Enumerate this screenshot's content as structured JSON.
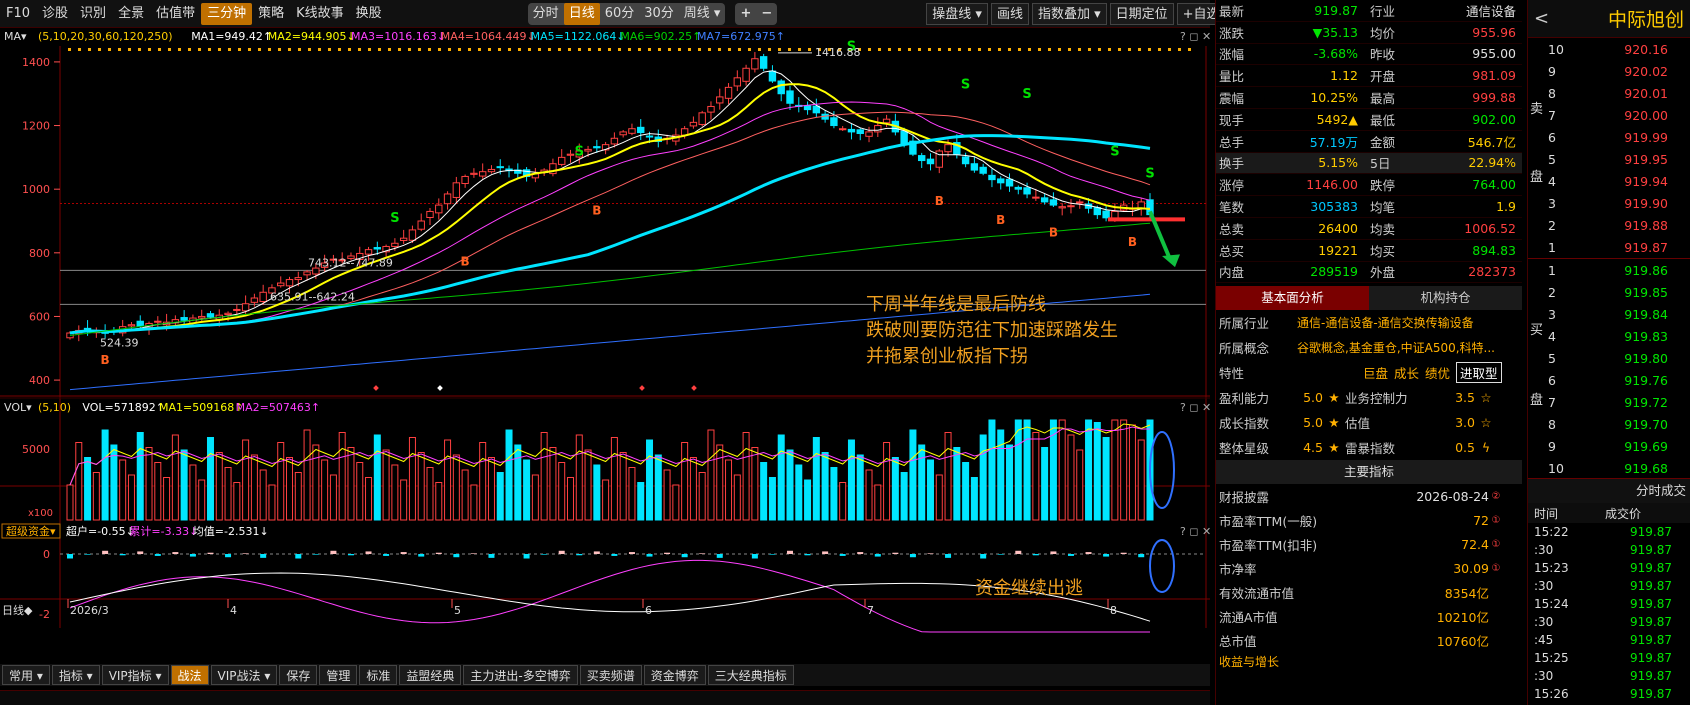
{
  "topbar": {
    "items": [
      {
        "id": "f10",
        "label": "F10",
        "active": false
      },
      {
        "id": "diagnose",
        "label": "诊股",
        "active": false
      },
      {
        "id": "identify",
        "label": "识別",
        "active": false
      },
      {
        "id": "overview",
        "label": "全景",
        "active": false
      },
      {
        "id": "valuation",
        "label": "估值带",
        "active": false
      },
      {
        "id": "three",
        "label": "三分钟",
        "active": true
      },
      {
        "id": "strategy",
        "label": "策略",
        "active": false
      },
      {
        "id": "kstory",
        "label": "K线故事",
        "active": false
      },
      {
        "id": "switch",
        "label": "换股",
        "active": false
      }
    ],
    "periods": [
      {
        "label": "分时",
        "active": false
      },
      {
        "label": "日线",
        "active": true
      },
      {
        "label": "60分",
        "active": false
      },
      {
        "label": "30分",
        "active": false
      },
      {
        "label": "周线 ▾",
        "active": false
      }
    ],
    "zoom_in": "+",
    "zoom_out": "−",
    "right": [
      "操盘线 ▾",
      "画线",
      "指数叠加 ▾",
      "日期定位",
      "+自选 ▾"
    ],
    "help": "?",
    "gear": "⚙"
  },
  "ma_header": {
    "label": "MA▾",
    "params": "(5,10,20,30,60,120,250)",
    "items": [
      {
        "text": "MA1=949.42↑",
        "color": "#ffffff"
      },
      {
        "text": "MA2=944.905↓",
        "color": "#ffff00"
      },
      {
        "text": "MA3=1016.163↓",
        "color": "#ff40ff"
      },
      {
        "text": "MA4=1064.449↓",
        "color": "#ff6060"
      },
      {
        "text": "MA5=1122.064↓",
        "color": "#00e5ff"
      },
      {
        "text": "MA6=902.25↑",
        "color": "#00d000"
      },
      {
        "text": "MA7=672.975↑",
        "color": "#4080ff"
      }
    ]
  },
  "vol_header": {
    "label": "VOL▾",
    "params": "(5,10)",
    "items": [
      {
        "text": "VOL=571892↑",
        "color": "#ffffff"
      },
      {
        "text": "MA1=509168↑",
        "color": "#ffff00"
      },
      {
        "text": "MA2=507463↑",
        "color": "#ff40ff"
      }
    ]
  },
  "fund_header": {
    "label": "超级资金▾",
    "items": [
      {
        "text": "超户=-0.55↓",
        "color": "#ffffff"
      },
      {
        "text": "累计=-3.33↓",
        "color": "#ff40ff"
      },
      {
        "text": "均值=-2.531↓",
        "color": "#ffffff"
      }
    ]
  },
  "panel_buttons": "? ◻ ✕",
  "price_axis": [
    "1400",
    "1200",
    "1000",
    "800",
    "600",
    "400"
  ],
  "vol_axis": [
    "5000",
    "x100"
  ],
  "fund_axis": [
    "0",
    "-2"
  ],
  "date_axis": {
    "label": "日线◆",
    "ticks": [
      "2026/3",
      "4",
      "5",
      "6",
      "7",
      "8"
    ]
  },
  "annotations": {
    "high": "1416.88",
    "low": "524.39",
    "lvl1": "743.12--747.89",
    "lvl2": "635.91--642.24",
    "note1": "下周半年线是最后防线",
    "note2": "跌破则要防范往下加速踩踏发生",
    "note3": "并拖累创业板指下拐",
    "note4": "资金继续出逃"
  },
  "chart_data": {
    "type": "candlestick",
    "x_range": [
      "2026-03",
      "2026-08"
    ],
    "y_range": [
      350,
      1450
    ],
    "closes": [
      548,
      556,
      560,
      552,
      547,
      555,
      568,
      574,
      570,
      578,
      585,
      582,
      590,
      588,
      595,
      600,
      598,
      604,
      610,
      622,
      640,
      658,
      676,
      690,
      705,
      716,
      722,
      740,
      752,
      768,
      780,
      778,
      790,
      798,
      810,
      812,
      820,
      830,
      846,
      872,
      900,
      930,
      950,
      985,
      1020,
      1040,
      1050,
      1055,
      1062,
      1070,
      1058,
      1050,
      1040,
      1048,
      1060,
      1080,
      1100,
      1110,
      1120,
      1125,
      1130,
      1140,
      1160,
      1180,
      1190,
      1178,
      1166,
      1150,
      1160,
      1170,
      1190,
      1210,
      1240,
      1260,
      1290,
      1320,
      1350,
      1380,
      1410,
      1380,
      1340,
      1300,
      1270,
      1260,
      1250,
      1240,
      1220,
      1200,
      1190,
      1180,
      1175,
      1180,
      1200,
      1220,
      1180,
      1140,
      1110,
      1090,
      1080,
      1120,
      1140,
      1110,
      1080,
      1060,
      1050,
      1030,
      1020,
      1010,
      1000,
      985,
      975,
      960,
      950,
      945,
      948,
      960,
      940,
      920,
      910,
      930,
      950,
      940,
      960,
      920
    ]
  },
  "quote": {
    "rows": [
      {
        "l": "最新",
        "v": "919.87",
        "vc": "green",
        "l2": "行业",
        "v2": "通信设备",
        "v2c": "white"
      },
      {
        "l": "涨跌",
        "v": "▼35.13",
        "vc": "green",
        "l2": "均价",
        "v2": "955.96",
        "v2c": "red"
      },
      {
        "l": "涨幅",
        "v": "-3.68%",
        "vc": "green",
        "l2": "昨收",
        "v2": "955.00",
        "v2c": "white"
      },
      {
        "l": "量比",
        "v": "1.12",
        "vc": "yellow",
        "l2": "开盘",
        "v2": "981.09",
        "v2c": "red"
      },
      {
        "l": "震幅",
        "v": "10.25%",
        "vc": "yellow",
        "l2": "最高",
        "v2": "999.88",
        "v2c": "red"
      },
      {
        "l": "现手",
        "v": "5492▲",
        "vc": "yellow",
        "l2": "最低",
        "v2": "902.00",
        "v2c": "green"
      },
      {
        "l": "总手",
        "v": "57.19万",
        "vc": "cyan",
        "l2": "金额",
        "v2": "546.7亿",
        "v2c": "yellow"
      },
      {
        "l": "换手",
        "v": "5.15%",
        "vc": "yellow",
        "l2": "5日",
        "v2": "22.94%",
        "v2c": "yellow"
      },
      {
        "l": "涨停",
        "v": "1146.00",
        "vc": "red",
        "l2": "跌停",
        "v2": "764.00",
        "v2c": "green"
      },
      {
        "l": "笔数",
        "v": "305383",
        "vc": "cyan",
        "l2": "均笔",
        "v2": "1.9",
        "v2c": "yellow"
      },
      {
        "l": "总卖",
        "v": "26400",
        "vc": "yellow",
        "l2": "均卖",
        "v2": "1006.52",
        "v2c": "red"
      },
      {
        "l": "总买",
        "v": "19221",
        "vc": "yellow",
        "l2": "均买",
        "v2": "894.83",
        "v2c": "green"
      },
      {
        "l": "内盘",
        "v": "289519",
        "vc": "green",
        "l2": "外盘",
        "v2": "282373",
        "v2c": "red"
      }
    ],
    "tabs": [
      "基本面分析",
      "机构持仓"
    ],
    "industry_label": "所属行业",
    "industry": "通信-通信设备-通信交换传输设备",
    "concept_label": "所属概念",
    "concept": "谷歌概念,基金重仓,中证A500,科特...",
    "feature_label": "特性",
    "features": [
      "巨盘",
      "成长",
      "绩优",
      "进取型"
    ],
    "ratings": [
      {
        "l": "盈利能力",
        "v": "5.0",
        "l2": "业务控制力",
        "v2": "3.5",
        "icon2": "☆"
      },
      {
        "l": "成长指数",
        "v": "5.0",
        "l2": "估值",
        "v2": "3.0",
        "icon2": "☆"
      },
      {
        "l": "整体星级",
        "v": "4.5",
        "l2": "雷暴指数",
        "v2": "0.5",
        "icon2": "ϟ"
      }
    ],
    "main_title": "主要指标",
    "indicators": [
      {
        "l": "财报披露",
        "v": "2026-08-24",
        "m": "②"
      },
      {
        "l": "市盈率TTM(一般)",
        "v": "72",
        "m": "①"
      },
      {
        "l": "市盈率TTM(扣非)",
        "v": "72.4",
        "m": "①"
      },
      {
        "l": "市净率",
        "v": "30.09",
        "m": "①"
      },
      {
        "l": "有效流通市值",
        "v": "8354亿",
        "m": ""
      },
      {
        "l": "流通A市值",
        "v": "10210亿",
        "m": ""
      },
      {
        "l": "总市值",
        "v": "10760亿",
        "m": ""
      }
    ],
    "footer": "收益与增长"
  },
  "book": {
    "title": "中际旭创",
    "back": "<",
    "sell_label": [
      "卖",
      "盘"
    ],
    "buy_label": [
      "买",
      "盘"
    ],
    "sell": [
      {
        "lv": "10",
        "p": "920.16"
      },
      {
        "lv": "9",
        "p": "920.02"
      },
      {
        "lv": "8",
        "p": "920.01"
      },
      {
        "lv": "7",
        "p": "920.00"
      },
      {
        "lv": "6",
        "p": "919.99"
      },
      {
        "lv": "5",
        "p": "919.95"
      },
      {
        "lv": "4",
        "p": "919.94"
      },
      {
        "lv": "3",
        "p": "919.90"
      },
      {
        "lv": "2",
        "p": "919.88"
      },
      {
        "lv": "1",
        "p": "919.87"
      }
    ],
    "buy": [
      {
        "lv": "1",
        "p": "919.86"
      },
      {
        "lv": "2",
        "p": "919.85"
      },
      {
        "lv": "3",
        "p": "919.84"
      },
      {
        "lv": "4",
        "p": "919.83"
      },
      {
        "lv": "5",
        "p": "919.80"
      },
      {
        "lv": "6",
        "p": "919.76"
      },
      {
        "lv": "7",
        "p": "919.72"
      },
      {
        "lv": "8",
        "p": "919.70"
      },
      {
        "lv": "9",
        "p": "919.69"
      },
      {
        "lv": "10",
        "p": "919.68"
      }
    ],
    "ticks_title": "分时成交",
    "col_time": "时间",
    "col_price": "成交价",
    "ticks": [
      {
        "t": "15:22",
        "p": "919.87"
      },
      {
        "t": ":30",
        "p": "919.87"
      },
      {
        "t": "15:23",
        "p": "919.87"
      },
      {
        "t": ":30",
        "p": "919.87"
      },
      {
        "t": "15:24",
        "p": "919.87"
      },
      {
        "t": ":30",
        "p": "919.87"
      },
      {
        "t": ":45",
        "p": "919.87"
      },
      {
        "t": "15:25",
        "p": "919.87"
      },
      {
        "t": ":30",
        "p": "919.87"
      },
      {
        "t": "15:26",
        "p": "919.87"
      }
    ]
  },
  "bottombar": {
    "items": [
      {
        "l": "常用 ▾",
        "a": false
      },
      {
        "l": "指标 ▾",
        "a": false
      },
      {
        "l": "VIP指标 ▾",
        "a": false
      },
      {
        "l": "战法",
        "a": true
      },
      {
        "l": "VIP战法 ▾",
        "a": false
      },
      {
        "l": "保存",
        "a": false
      },
      {
        "l": "管理",
        "a": false
      },
      {
        "l": "标准",
        "a": false
      },
      {
        "l": "益盟经典",
        "a": false
      },
      {
        "l": "主力进出-多空博弈",
        "a": false
      },
      {
        "l": "买卖频谱",
        "a": false
      },
      {
        "l": "资金博弈",
        "a": false
      },
      {
        "l": "三大经典指标",
        "a": false
      }
    ]
  }
}
